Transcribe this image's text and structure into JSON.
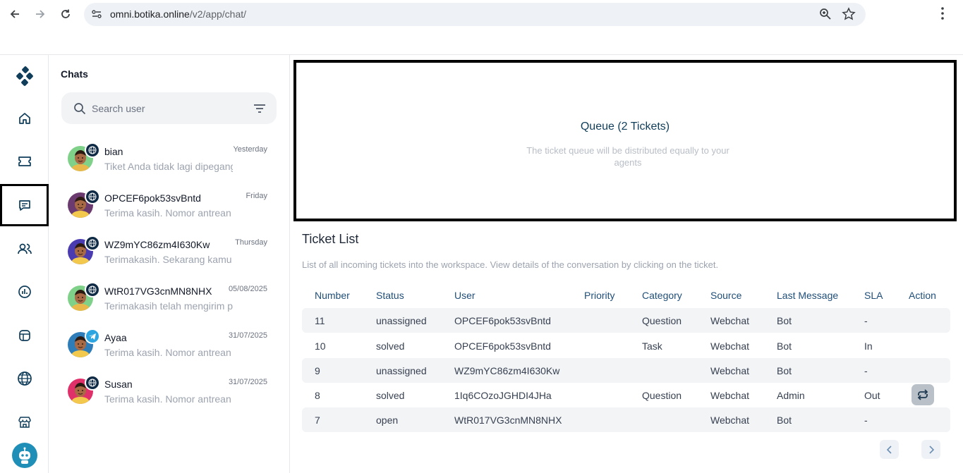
{
  "browser": {
    "url_host": "omni.botika.online",
    "url_path": "/v2/app/chat/"
  },
  "rail": {
    "items": [
      "logo",
      "home",
      "tickets",
      "chats",
      "contacts",
      "reports",
      "integrations",
      "channels",
      "store",
      "bot"
    ],
    "active": "chats"
  },
  "chats": {
    "title": "Chats",
    "search_placeholder": "Search user",
    "items": [
      {
        "name": "bian",
        "time": "Yesterday",
        "preview": "Tiket Anda tidak lagi dipegang",
        "channel": "web",
        "avatar_bg": "#7fd18a",
        "shirt": "#e8b84a"
      },
      {
        "name": "OPCEF6pok53svBntd",
        "time": "Friday",
        "preview": "Terima kasih. Nomor antrean Anda",
        "channel": "web",
        "avatar_bg": "#6b3a6e",
        "shirt": "#f2c94c"
      },
      {
        "name": "WZ9mYC86zm4I630Kw",
        "time": "Thursday",
        "preview": "Terimakasih. Sekarang kamu sudah",
        "channel": "web",
        "avatar_bg": "#4b3bb0",
        "shirt": "#f2c94c"
      },
      {
        "name": "WtR017VG3cnMN8NHX",
        "time": "05/08/2025",
        "preview": "Terimakasih telah mengirim pesan",
        "channel": "web",
        "avatar_bg": "#7fd18a",
        "shirt": "#e8b84a"
      },
      {
        "name": "Ayaa",
        "time": "31/07/2025",
        "preview": "Terima kasih. Nomor antrean Anda",
        "channel": "telegram",
        "avatar_bg": "#2f7db8",
        "shirt": "#f2c94c"
      },
      {
        "name": "Susan",
        "time": "31/07/2025",
        "preview": "Terima kasih. Nomor antrean Anda",
        "channel": "web",
        "avatar_bg": "#e0306a",
        "shirt": "#f2c94c"
      }
    ]
  },
  "queue": {
    "title": "Queue (2 Tickets)",
    "description": "The ticket queue will be distributed equally to your agents"
  },
  "ticket_list": {
    "title": "Ticket List",
    "description": "List of all incoming tickets into the workspace. View details of the conversation by clicking on the ticket.",
    "columns": [
      "Number",
      "Status",
      "User",
      "Priority",
      "Category",
      "Source",
      "Last Message",
      "SLA",
      "Action"
    ],
    "rows": [
      {
        "number": "11",
        "status": "unassigned",
        "user": "OPCEF6pok53svBntd",
        "priority": "",
        "category": "Question",
        "source": "Webchat",
        "last_message": "Bot",
        "sla": "-",
        "action": false
      },
      {
        "number": "10",
        "status": "solved",
        "user": "OPCEF6pok53svBntd",
        "priority": "",
        "category": "Task",
        "source": "Webchat",
        "last_message": "Bot",
        "sla": "In",
        "action": false
      },
      {
        "number": "9",
        "status": "unassigned",
        "user": "WZ9mYC86zm4I630Kw",
        "priority": "",
        "category": "",
        "source": "Webchat",
        "last_message": "Bot",
        "sla": "-",
        "action": false
      },
      {
        "number": "8",
        "status": "solved",
        "user": "1Iq6COzoJGHDI4JHa",
        "priority": "",
        "category": "Question",
        "source": "Webchat",
        "last_message": "Admin",
        "sla": "Out",
        "action": true
      },
      {
        "number": "7",
        "status": "open",
        "user": "WtR017VG3cnMN8NHX",
        "priority": "",
        "category": "",
        "source": "Webchat",
        "last_message": "Bot",
        "sla": "-",
        "action": false
      }
    ]
  },
  "colors": {
    "accent_dark": "#0f3d5a",
    "header_text": "#1f4e79",
    "row_shade": "#f3f4f6"
  }
}
